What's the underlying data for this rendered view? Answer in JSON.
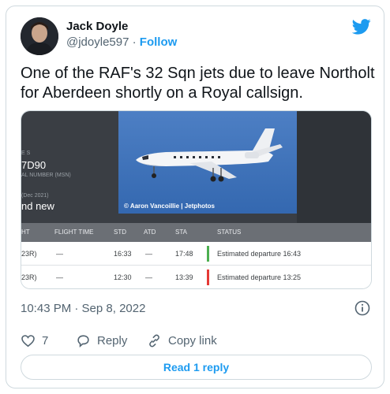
{
  "author": {
    "name": "Jack Doyle",
    "handle": "@jdoyle597",
    "separator": " · ",
    "follow_label": "Follow"
  },
  "tweet": {
    "text": "One of the RAF's 32 Sqn jets due to leave Northolt for Aberdeen shortly on a Royal callsign."
  },
  "media": {
    "panel": {
      "line1": "E S",
      "line2": "7D90",
      "line3": "AL NUMBER (MSN)",
      "line4": "(Dec 2021)",
      "line5": "nd new"
    },
    "photo_credit": "© Aaron Vancoillie | Jetphotos",
    "table": {
      "headers": [
        "HT",
        "FLIGHT TIME",
        "STD",
        "ATD",
        "STA",
        "STATUS"
      ],
      "rows": [
        {
          "c0": "23R)",
          "flight_time": "—",
          "std": "16:33",
          "atd": "—",
          "sta": "17:48",
          "status": "Estimated departure 16:43",
          "status_color": "#4caf50"
        },
        {
          "c0": "23R)",
          "flight_time": "—",
          "std": "12:30",
          "atd": "—",
          "sta": "13:39",
          "status": "Estimated departure 13:25",
          "status_color": "#e53935"
        }
      ]
    }
  },
  "timestamp": "10:43 PM · Sep 8, 2022",
  "actions": {
    "like_count": "7",
    "reply_label": "Reply",
    "copy_link_label": "Copy link"
  },
  "read_replies_label": "Read 1 reply",
  "colors": {
    "accent": "#1d9bf0",
    "muted": "#536471",
    "border": "#cfd9de"
  }
}
